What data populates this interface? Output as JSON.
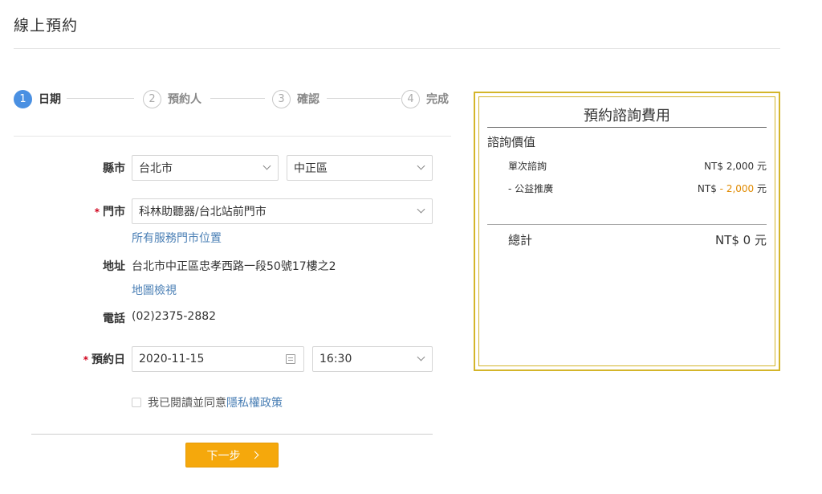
{
  "page": {
    "title": "線上預約"
  },
  "stepper": {
    "steps": [
      {
        "num": "1",
        "label": "日期"
      },
      {
        "num": "2",
        "label": "預約人"
      },
      {
        "num": "3",
        "label": "確認"
      },
      {
        "num": "4",
        "label": "完成"
      }
    ]
  },
  "form": {
    "county": {
      "label": "縣市",
      "city_value": "台北市",
      "district_value": "中正區"
    },
    "store": {
      "label": "門市",
      "value": "科林助聽器/台北站前門市",
      "link": "所有服務門市位置"
    },
    "address": {
      "label": "地址",
      "value": "台北市中正區忠孝西路一段50號17樓之2",
      "link": "地圖檢視"
    },
    "phone": {
      "label": "電話",
      "value": "(02)2375-2882"
    },
    "date": {
      "label": "預約日",
      "date_value": "2020-11-15",
      "time_value": "16:30"
    },
    "required_mark": "*",
    "agree_text": "我已閱讀並同意",
    "privacy_link": "隱私權政策",
    "next_label": "下一步"
  },
  "fee": {
    "title": "預約諮詢費用",
    "section": "諮詢價值",
    "single_label": "單次諮詢",
    "single_value": "NT$ 2,000 元",
    "discount_label": "- 公益推廣",
    "discount_prefix": "NT$ ",
    "discount_amount": "- 2,000",
    "discount_suffix": " 元",
    "total_label": "總計",
    "total_value": "NT$ 0 元"
  },
  "colors": {
    "accent": "#4a90e2",
    "button": "#f5a80c",
    "panel_border": "#d4b52a",
    "link": "#4a7fb5"
  }
}
